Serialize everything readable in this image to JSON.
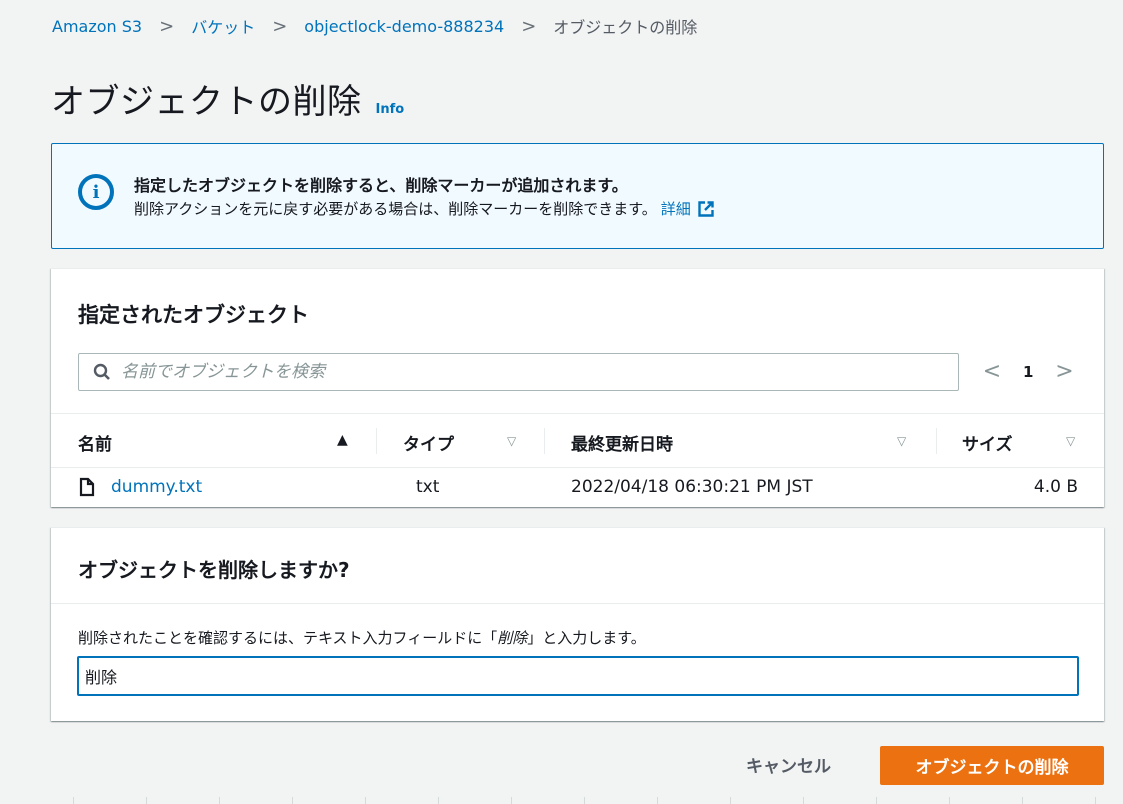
{
  "breadcrumb": {
    "items": [
      "Amazon S3",
      "バケット",
      "objectlock-demo-888234"
    ],
    "current": "オブジェクトの削除",
    "separator": ">"
  },
  "page": {
    "title": "オブジェクトの削除",
    "info_label": "Info"
  },
  "alert": {
    "icon": "info-circle-icon",
    "title": "指定したオブジェクトを削除すると、削除マーカーが追加されます。",
    "body": "削除アクションを元に戻す必要がある場合は、削除マーカーを削除できます。",
    "link_label": "詳細"
  },
  "objects_panel": {
    "title": "指定されたオブジェクト",
    "search_placeholder": "名前でオブジェクトを検索",
    "pager": {
      "prev": "<",
      "page": "1",
      "next": ">"
    },
    "columns": [
      "名前",
      "タイプ",
      "最終更新日時",
      "サイズ"
    ],
    "rows": [
      {
        "name": "dummy.txt",
        "type": "txt",
        "modified": "2022/04/18 06:30:21 PM JST",
        "size": "4.0 B"
      }
    ]
  },
  "confirm_panel": {
    "title": "オブジェクトを削除しますか?",
    "label_prefix": "削除されたことを確認するには、テキスト入力フィールドに「",
    "label_keyword": "削除",
    "label_suffix": "」と入力します。",
    "input_value": "削除"
  },
  "actions": {
    "cancel_label": "キャンセル",
    "delete_label": "オブジェクトの削除"
  },
  "colors": {
    "link": "#0073bb",
    "primary_button": "#ec7211",
    "alert_bg": "#f1faff",
    "page_bg": "#f2f3f3"
  }
}
